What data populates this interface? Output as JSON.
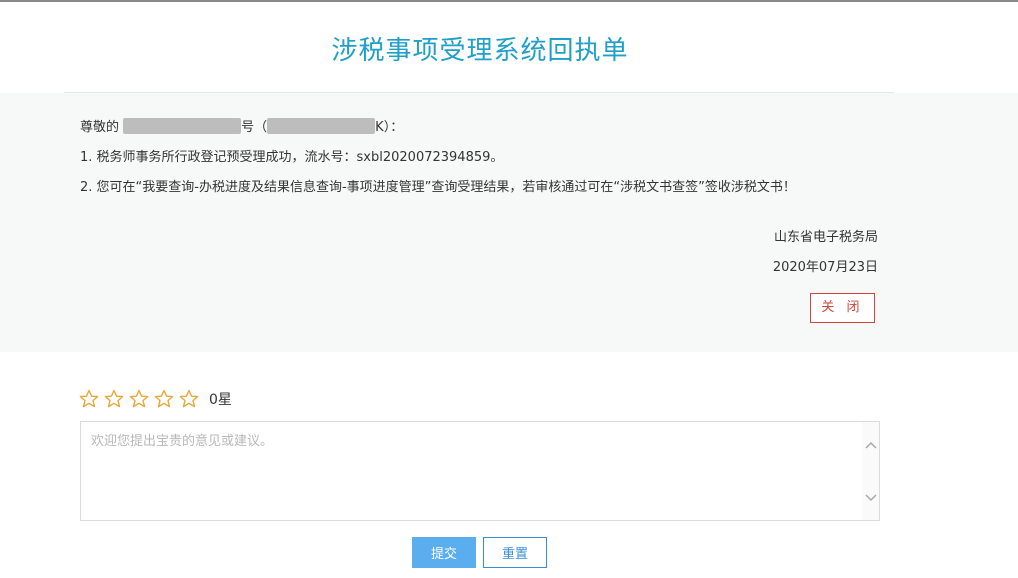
{
  "page": {
    "title": "涉税事项受理系统回执单"
  },
  "receipt": {
    "greeting_prefix": "尊敬的",
    "greeting_mid": "号（",
    "greeting_suffix": "K）：",
    "line1": "1. 税务师事务所行政登记预受理成功，流水号：sxbl2020072394859。",
    "line2": "2. 您可在“我要查询-办税进度及结果信息查询-事项进度管理”查询受理结果，若审核通过可在“涉税文书查签”签收涉税文书！",
    "issuer": "山东省电子税务局",
    "date": "2020年07月23日",
    "close_label": "关 闭"
  },
  "rating": {
    "star_icon": "star-outline-icon",
    "star_color": "#e9a73a",
    "value": 0,
    "max": 5,
    "count_label": "0星"
  },
  "feedback": {
    "placeholder": "欢迎您提出宝贵的意见或建议。",
    "value": ""
  },
  "actions": {
    "submit_label": "提交",
    "reset_label": "重置"
  },
  "colors": {
    "title": "#1fa0c9",
    "close_border": "#d0443a",
    "submit_bg": "#5aaeed",
    "reset_border": "#3a8fd4"
  }
}
